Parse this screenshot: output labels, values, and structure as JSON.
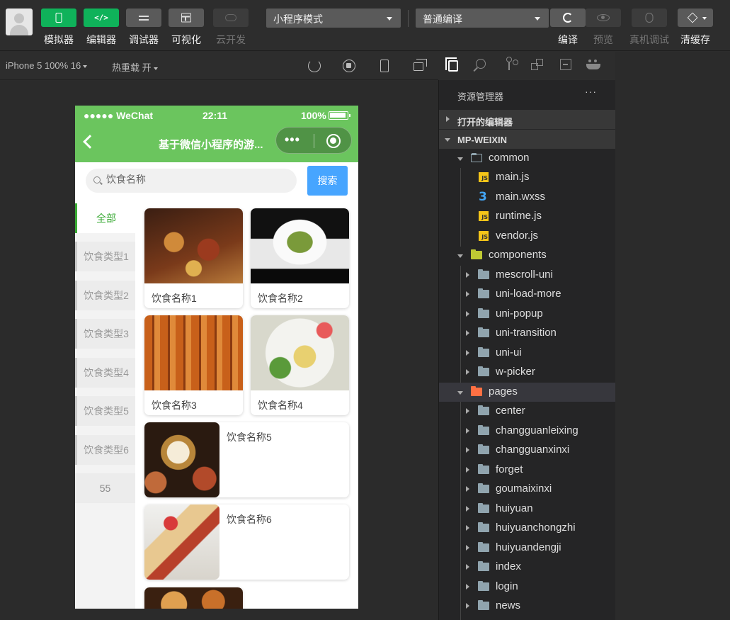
{
  "toolbar": {
    "left_tools": [
      {
        "label": "模拟器",
        "icon": "phone-icon"
      },
      {
        "label": "编辑器",
        "icon": "code-icon"
      },
      {
        "label": "调试器",
        "icon": "sliders-icon"
      },
      {
        "label": "可视化",
        "icon": "layout-icon"
      },
      {
        "label": "云开发",
        "icon": "cloud-icon"
      }
    ],
    "mode_select": "小程序模式",
    "compile_select": "普通编译",
    "right_tools": [
      {
        "label": "编译",
        "icon": "refresh-icon"
      },
      {
        "label": "预览",
        "icon": "eye-icon"
      },
      {
        "label": "真机调试",
        "icon": "bug-icon"
      },
      {
        "label": "清缓存",
        "icon": "layers-icon"
      }
    ]
  },
  "simulator_bar": {
    "device": "iPhone 5 100% 16",
    "hot_reload": "热重载 开"
  },
  "phone": {
    "status": {
      "carrier": "●●●●● WeChat",
      "time": "22:11",
      "battery": "100%"
    },
    "nav_title": "基于微信小程序的游...",
    "capsule_dots": "•••",
    "search": {
      "placeholder": "饮食名称",
      "button": "搜索"
    },
    "categories": [
      "全部",
      "饮食类型1",
      "饮食类型2",
      "饮食类型3",
      "饮食类型4",
      "饮食类型5",
      "饮食类型6",
      "55"
    ],
    "foods": [
      "饮食名称1",
      "饮食名称2",
      "饮食名称3",
      "饮食名称4",
      "饮食名称5",
      "饮食名称6"
    ]
  },
  "explorer": {
    "title": "资源管理器",
    "more": "···",
    "open_editors": "打开的编辑器",
    "root": "MP-WEIXIN",
    "tree": [
      {
        "label": "common",
        "type": "folder-open"
      },
      {
        "label": "main.js",
        "type": "js"
      },
      {
        "label": "main.wxss",
        "type": "css"
      },
      {
        "label": "runtime.js",
        "type": "js"
      },
      {
        "label": "vendor.js",
        "type": "js"
      },
      {
        "label": "components",
        "type": "folder-components"
      },
      {
        "label": "mescroll-uni",
        "type": "folder"
      },
      {
        "label": "uni-load-more",
        "type": "folder"
      },
      {
        "label": "uni-popup",
        "type": "folder"
      },
      {
        "label": "uni-transition",
        "type": "folder"
      },
      {
        "label": "uni-ui",
        "type": "folder"
      },
      {
        "label": "w-picker",
        "type": "folder"
      },
      {
        "label": "pages",
        "type": "folder-pages"
      },
      {
        "label": "center",
        "type": "folder"
      },
      {
        "label": "changguanleixing",
        "type": "folder"
      },
      {
        "label": "changguanxinxi",
        "type": "folder"
      },
      {
        "label": "forget",
        "type": "folder"
      },
      {
        "label": "goumaixinxi",
        "type": "folder"
      },
      {
        "label": "huiyuan",
        "type": "folder"
      },
      {
        "label": "huiyuanchongzhi",
        "type": "folder"
      },
      {
        "label": "huiyuandengji",
        "type": "folder"
      },
      {
        "label": "index",
        "type": "folder"
      },
      {
        "label": "login",
        "type": "folder"
      },
      {
        "label": "news",
        "type": "folder"
      }
    ]
  },
  "colors": {
    "wechat_green": "#6bc55e",
    "toolbar_green": "#0fb25a",
    "search_blue": "#47a5ff",
    "active_category": "#3aaa35"
  }
}
